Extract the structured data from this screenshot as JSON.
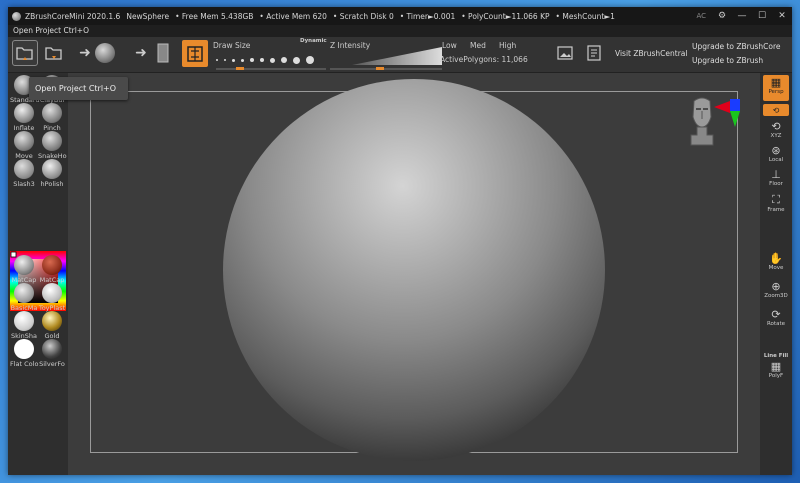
{
  "titlebar": {
    "app": "ZBrushCoreMini 2020.1.6",
    "project": "NewSphere",
    "free_mem": "• Free Mem 5.438GB",
    "active_mem": "• Active Mem 620",
    "scratch": "• Scratch Disk 0",
    "timer": "• Timer►0.001",
    "polycount": "• PolyCount►11.066 KP",
    "meshcount": "• MeshCount►1",
    "ac": "AC",
    "min_glyph": "—",
    "max_glyph": "☐",
    "close_glyph": "✕"
  },
  "menubar": {
    "open_project": "Open Project Ctrl+O"
  },
  "toolbar": {
    "draw_size_label": "Draw Size",
    "dynamic_label": "Dynamic",
    "z_intensity_label": "Z Intensity",
    "low": "Low",
    "med": "Med",
    "high": "High",
    "active_polygons": "ActivePolygons: 11,066",
    "visit": "Visit ZBrushCentral",
    "upgrade_core": "Upgrade to ZBrushCore",
    "upgrade_zbrush": "Upgrade to ZBrush"
  },
  "tooltip": {
    "text": "Open Project  Ctrl+O"
  },
  "brushes": [
    {
      "label": "Standard"
    },
    {
      "label": "ClayBui"
    },
    {
      "label": "Inflate"
    },
    {
      "label": "Pinch"
    },
    {
      "label": "Move"
    },
    {
      "label": "SnakeHo"
    },
    {
      "label": "Slash3"
    },
    {
      "label": "hPolish"
    }
  ],
  "materials": [
    {
      "label": "MatCap"
    },
    {
      "label": "MatCap"
    },
    {
      "label": "BasicMa"
    },
    {
      "label": "ToyPlast"
    },
    {
      "label": "SkinSha"
    },
    {
      "label": "Gold"
    },
    {
      "label": "Flat Colo"
    },
    {
      "label": "SilverFo"
    }
  ],
  "right_tray": {
    "persp": "Persp",
    "xyz": "XYZ",
    "local": "Local",
    "floor": "Floor",
    "frame": "Frame",
    "move": "Move",
    "zoom3d": "Zoom3D",
    "rotate": "Rotate",
    "line_fill": "Line Fill",
    "polyf": "PolyF"
  },
  "colors": {
    "accent": "#e88a2c",
    "bg": "#2b2b2b",
    "viewport": "#3c3c3c"
  }
}
